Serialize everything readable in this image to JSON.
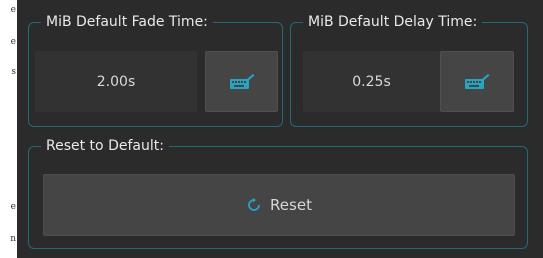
{
  "left_strip": {
    "letters": [
      "e",
      "e",
      "s",
      "e",
      "n"
    ]
  },
  "fade_group": {
    "title": "MiB Default Fade Time:",
    "value": "2.00s",
    "keyboard_icon": "keyboard-edit-icon"
  },
  "delay_group": {
    "title": "MiB Default Delay Time:",
    "value": "0.25s",
    "keyboard_icon": "keyboard-edit-icon"
  },
  "reset_group": {
    "title": "Reset to Default:",
    "button_label": "Reset",
    "button_icon": "refresh-icon"
  },
  "colors": {
    "accent": "#27a3c4",
    "border": "#1f6b78",
    "background": "#2b2b2b"
  }
}
